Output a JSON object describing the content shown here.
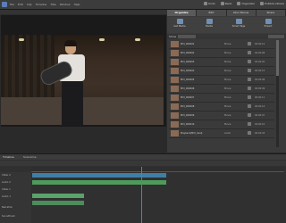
{
  "menubar": {
    "menus": [
      "File",
      "Edit",
      "Clip",
      "Timeline",
      "Title",
      "Window",
      "Help"
    ],
    "right_items": [
      "Undo",
      "Redo",
      "Organizer",
      "Publish+Share"
    ]
  },
  "panel": {
    "tabs": [
      "Organize",
      "Edit",
      "Disc Menus",
      "Share"
    ],
    "active_tab": "Organize",
    "subtools": [
      "Get Media",
      "Media",
      "Smart Tags",
      "Project"
    ],
    "filter_label": "Show"
  },
  "assets": [
    {
      "name": "MVI_000001",
      "type": "Movie",
      "dur": "00:00:12"
    },
    {
      "name": "MVI_000002",
      "type": "Movie",
      "dur": "00:00:08"
    },
    {
      "name": "MVI_000003",
      "type": "Movie",
      "dur": "00:00:20"
    },
    {
      "name": "MVI_000004",
      "type": "Movie",
      "dur": "00:00:15"
    },
    {
      "name": "MVI_000005",
      "type": "Movie",
      "dur": "00:00:06"
    },
    {
      "name": "MVI_000006",
      "type": "Movie",
      "dur": "00:00:09"
    },
    {
      "name": "MVI_000007",
      "type": "Movie",
      "dur": "00:00:11"
    },
    {
      "name": "MVI_000008",
      "type": "Movie",
      "dur": "00:00:14"
    },
    {
      "name": "MVI_000009",
      "type": "Movie",
      "dur": "00:00:07"
    },
    {
      "name": "MVI_000010",
      "type": "Movie",
      "dur": "00:00:10"
    },
    {
      "name": "Playback(MVI_dual)",
      "type": "Audio",
      "dur": "00:02:43"
    }
  ],
  "timeline": {
    "title": "Timeline",
    "subtitle": "Sceneline",
    "tracks": [
      "Video 2",
      "Audio 2",
      "Video 1",
      "Audio 1",
      "Narration",
      "Soundtrack"
    ]
  }
}
